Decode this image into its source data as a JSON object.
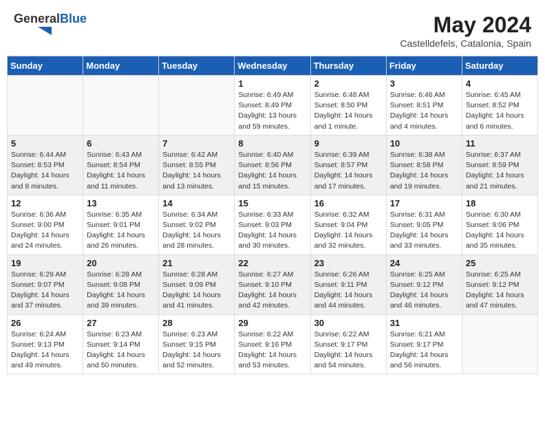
{
  "app": {
    "name_general": "General",
    "name_blue": "Blue"
  },
  "title": "May 2024",
  "subtitle": "Castelldefels, Catalonia, Spain",
  "days_of_week": [
    "Sunday",
    "Monday",
    "Tuesday",
    "Wednesday",
    "Thursday",
    "Friday",
    "Saturday"
  ],
  "weeks": [
    [
      {
        "day": "",
        "info": ""
      },
      {
        "day": "",
        "info": ""
      },
      {
        "day": "",
        "info": ""
      },
      {
        "day": "1",
        "info": "Sunrise: 6:49 AM\nSunset: 8:49 PM\nDaylight: 13 hours\nand 59 minutes."
      },
      {
        "day": "2",
        "info": "Sunrise: 6:48 AM\nSunset: 8:50 PM\nDaylight: 14 hours\nand 1 minute."
      },
      {
        "day": "3",
        "info": "Sunrise: 6:46 AM\nSunset: 8:51 PM\nDaylight: 14 hours\nand 4 minutes."
      },
      {
        "day": "4",
        "info": "Sunrise: 6:45 AM\nSunset: 8:52 PM\nDaylight: 14 hours\nand 6 minutes."
      }
    ],
    [
      {
        "day": "5",
        "info": "Sunrise: 6:44 AM\nSunset: 8:53 PM\nDaylight: 14 hours\nand 8 minutes."
      },
      {
        "day": "6",
        "info": "Sunrise: 6:43 AM\nSunset: 8:54 PM\nDaylight: 14 hours\nand 11 minutes."
      },
      {
        "day": "7",
        "info": "Sunrise: 6:42 AM\nSunset: 8:55 PM\nDaylight: 14 hours\nand 13 minutes."
      },
      {
        "day": "8",
        "info": "Sunrise: 6:40 AM\nSunset: 8:56 PM\nDaylight: 14 hours\nand 15 minutes."
      },
      {
        "day": "9",
        "info": "Sunrise: 6:39 AM\nSunset: 8:57 PM\nDaylight: 14 hours\nand 17 minutes."
      },
      {
        "day": "10",
        "info": "Sunrise: 6:38 AM\nSunset: 8:58 PM\nDaylight: 14 hours\nand 19 minutes."
      },
      {
        "day": "11",
        "info": "Sunrise: 6:37 AM\nSunset: 8:59 PM\nDaylight: 14 hours\nand 21 minutes."
      }
    ],
    [
      {
        "day": "12",
        "info": "Sunrise: 6:36 AM\nSunset: 9:00 PM\nDaylight: 14 hours\nand 24 minutes."
      },
      {
        "day": "13",
        "info": "Sunrise: 6:35 AM\nSunset: 9:01 PM\nDaylight: 14 hours\nand 26 minutes."
      },
      {
        "day": "14",
        "info": "Sunrise: 6:34 AM\nSunset: 9:02 PM\nDaylight: 14 hours\nand 28 minutes."
      },
      {
        "day": "15",
        "info": "Sunrise: 6:33 AM\nSunset: 9:03 PM\nDaylight: 14 hours\nand 30 minutes."
      },
      {
        "day": "16",
        "info": "Sunrise: 6:32 AM\nSunset: 9:04 PM\nDaylight: 14 hours\nand 32 minutes."
      },
      {
        "day": "17",
        "info": "Sunrise: 6:31 AM\nSunset: 9:05 PM\nDaylight: 14 hours\nand 33 minutes."
      },
      {
        "day": "18",
        "info": "Sunrise: 6:30 AM\nSunset: 9:06 PM\nDaylight: 14 hours\nand 35 minutes."
      }
    ],
    [
      {
        "day": "19",
        "info": "Sunrise: 6:29 AM\nSunset: 9:07 PM\nDaylight: 14 hours\nand 37 minutes."
      },
      {
        "day": "20",
        "info": "Sunrise: 6:28 AM\nSunset: 9:08 PM\nDaylight: 14 hours\nand 39 minutes."
      },
      {
        "day": "21",
        "info": "Sunrise: 6:28 AM\nSunset: 9:09 PM\nDaylight: 14 hours\nand 41 minutes."
      },
      {
        "day": "22",
        "info": "Sunrise: 6:27 AM\nSunset: 9:10 PM\nDaylight: 14 hours\nand 42 minutes."
      },
      {
        "day": "23",
        "info": "Sunrise: 6:26 AM\nSunset: 9:11 PM\nDaylight: 14 hours\nand 44 minutes."
      },
      {
        "day": "24",
        "info": "Sunrise: 6:25 AM\nSunset: 9:12 PM\nDaylight: 14 hours\nand 46 minutes."
      },
      {
        "day": "25",
        "info": "Sunrise: 6:25 AM\nSunset: 9:12 PM\nDaylight: 14 hours\nand 47 minutes."
      }
    ],
    [
      {
        "day": "26",
        "info": "Sunrise: 6:24 AM\nSunset: 9:13 PM\nDaylight: 14 hours\nand 49 minutes."
      },
      {
        "day": "27",
        "info": "Sunrise: 6:23 AM\nSunset: 9:14 PM\nDaylight: 14 hours\nand 50 minutes."
      },
      {
        "day": "28",
        "info": "Sunrise: 6:23 AM\nSunset: 9:15 PM\nDaylight: 14 hours\nand 52 minutes."
      },
      {
        "day": "29",
        "info": "Sunrise: 6:22 AM\nSunset: 9:16 PM\nDaylight: 14 hours\nand 53 minutes."
      },
      {
        "day": "30",
        "info": "Sunrise: 6:22 AM\nSunset: 9:17 PM\nDaylight: 14 hours\nand 54 minutes."
      },
      {
        "day": "31",
        "info": "Sunrise: 6:21 AM\nSunset: 9:17 PM\nDaylight: 14 hours\nand 56 minutes."
      },
      {
        "day": "",
        "info": ""
      }
    ]
  ]
}
